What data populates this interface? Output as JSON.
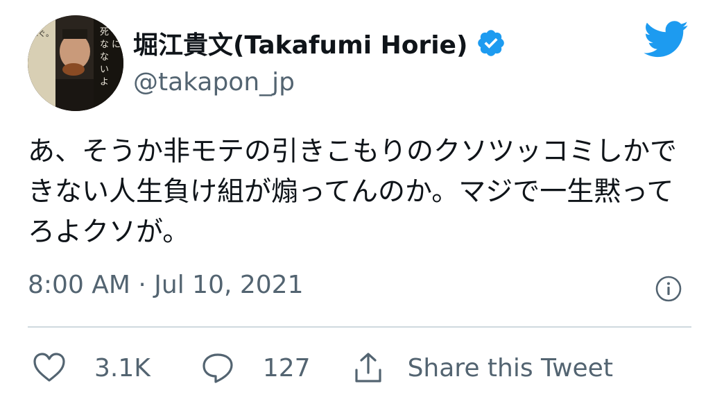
{
  "user": {
    "display_name": "堀江貴文(Takafumi Horie)",
    "handle": "@takapon_jp",
    "avatar_icon": "book-cover-avatar",
    "avatar_text": "死なないように稼ぐ。"
  },
  "tweet": {
    "lines": [
      "あ、そうか非モテの引きこもりのクソツッコミしかで",
      "きない人生負け組が煽ってんのか。マジで一生黙って",
      "ろよクソが。"
    ],
    "timestamp": "8:00 AM · Jul 10, 2021"
  },
  "actions": {
    "like_count": "3.1K",
    "reply_count": "127",
    "share_label": "Share this Tweet"
  },
  "icons": {
    "logo": "twitter-bird-icon",
    "verified": "verified-badge-icon",
    "info": "info-icon",
    "like": "heart-icon",
    "reply": "speech-bubble-icon",
    "share": "share-icon"
  },
  "colors": {
    "brand_blue": "#1d9bf0",
    "text_primary": "#0f1419",
    "text_secondary": "#536471",
    "divider": "#cfd9de"
  }
}
